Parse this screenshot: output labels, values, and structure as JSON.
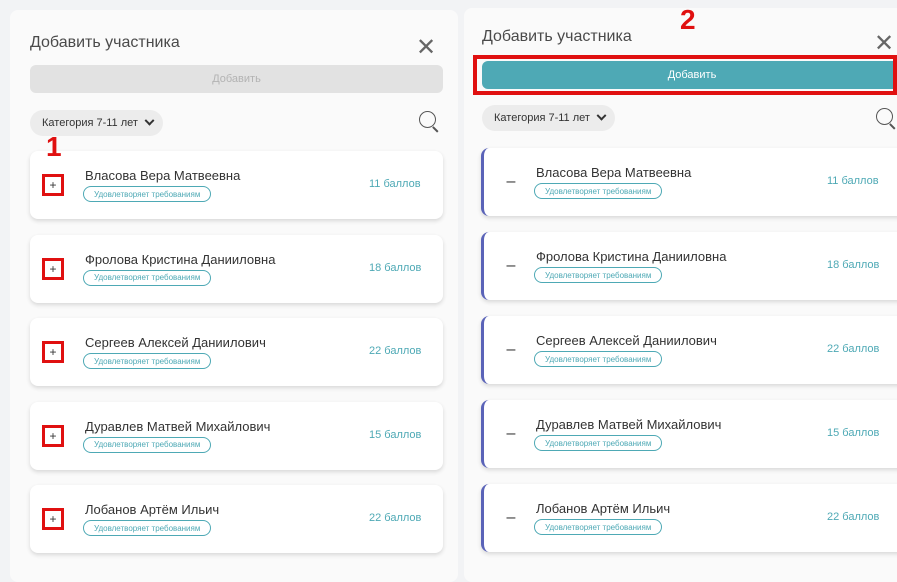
{
  "left_panel": {
    "title": "Добавить участника",
    "add_button": "Добавить",
    "category": "Категория 7-11 лет",
    "toggle_symbol": "+"
  },
  "right_panel": {
    "title": "Добавить участника",
    "add_button": "Добавить",
    "category": "Категория 7-11 лет",
    "toggle_symbol": "–"
  },
  "participants": [
    {
      "name": "Власова Вера Матвеевна",
      "status": "Удовлетворяет требованиям",
      "points": "11 баллов"
    },
    {
      "name": "Фролова Кристина Данииловна",
      "status": "Удовлетворяет требованиям",
      "points": "18 баллов"
    },
    {
      "name": "Сергеев Алексей Даниилович",
      "status": "Удовлетворяет требованиям",
      "points": "22 баллов"
    },
    {
      "name": "Дуравлев Матвей Михайлович",
      "status": "Удовлетворяет требованиям",
      "points": "15 баллов"
    },
    {
      "name": "Лобанов Артём Ильич",
      "status": "Удовлетворяет требованиям",
      "points": "22 баллов"
    }
  ],
  "icons": {
    "close": "close-icon",
    "search": "search-icon",
    "chevron": "chevron-down-icon"
  },
  "annotations": {
    "step1": "1",
    "step2": "2",
    "color": "#e01010"
  },
  "colors": {
    "accent": "#4ea9b5",
    "selected_border": "#5a63b8"
  }
}
